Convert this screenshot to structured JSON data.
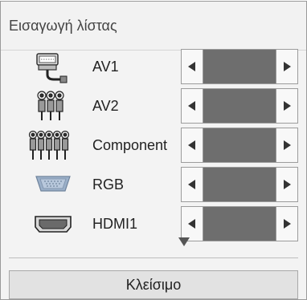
{
  "dialog": {
    "title": "Εισαγωγή λίστας",
    "close_label": "Κλείσιμο",
    "scroll_indicator": "▼"
  },
  "inputs": [
    {
      "label": "AV1",
      "icon": "scart-cable-icon",
      "value": ""
    },
    {
      "label": "AV2",
      "icon": "rca-av-cable-icon",
      "value": ""
    },
    {
      "label": "Component",
      "icon": "component-cable-icon",
      "value": ""
    },
    {
      "label": "RGB",
      "icon": "vga-connector-icon",
      "value": ""
    },
    {
      "label": "HDMI1",
      "icon": "hdmi-port-icon",
      "value": ""
    }
  ],
  "colors": {
    "selector_fill": "#6e6e6e",
    "arrow_button": "#f8f8f8",
    "panel_background": "#f3f3f3",
    "close_button": "#e2e2e2"
  }
}
